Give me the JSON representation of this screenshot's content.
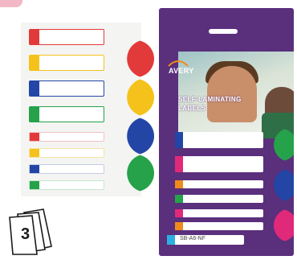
{
  "product": {
    "brand": "AVERY",
    "tagline_line1": "SELF-LAMINATING",
    "tagline_line2": "LABELS",
    "code": "SB-A6-NF"
  },
  "count_badge": {
    "number": "3"
  },
  "colors": {
    "red": "#e23a3a",
    "yellow": "#f4c21a",
    "blue": "#2346a6",
    "green": "#25a24a",
    "magenta": "#e1297a",
    "orange": "#f08a1c",
    "cyan": "#2eaee0",
    "package_purple": "#5a2f7c"
  }
}
